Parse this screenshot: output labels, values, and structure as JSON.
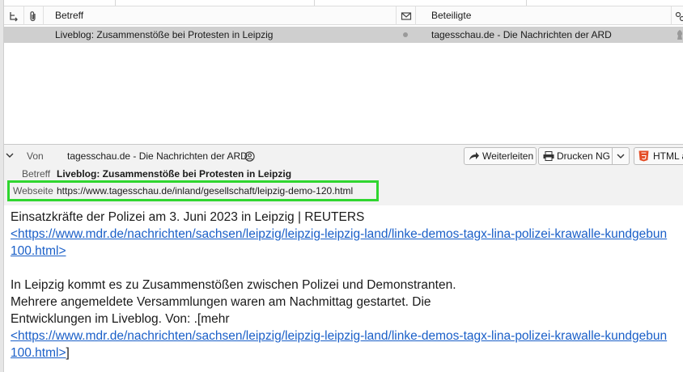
{
  "columns": {
    "subject": "Betreff",
    "participants": "Beteiligte"
  },
  "message_row": {
    "subject": "Liveblog: Zusammenstöße bei Protesten in Leipzig",
    "participants": "tagesschau.de - Die Nachrichten der ARD"
  },
  "header": {
    "from_label": "Von",
    "from_value": "tagesschau.de - Die Nachrichten der ARD",
    "subject_label": "Betreff",
    "subject_value": "Liveblog: Zusammenstöße bei Protesten in Leipzig",
    "website_label": "Webseite",
    "website_url": "https://www.tagesschau.de/inland/gesellschaft/leipzig-demo-120.html",
    "forward_label": "Weiterleiten",
    "print_label": "Drucken NG",
    "html_label": "HTML a"
  },
  "body": {
    "line1": "Einsatzkräfte der Polizei am 3. Juni 2023 in Leipzig | REUTERS",
    "link1_a": "<https://www.mdr.de/nachrichten/sachsen/leipzig/leipzig-leipzig-land/linke-demos-tagx-lina-polizei-krawalle-kundgebun",
    "link1_b": "100.html>",
    "para2_line1": "In Leipzig kommt es zu Zusammenstößen zwischen Polizei und Demonstranten.",
    "para2_line2": "Mehrere angemeldete Versammlungen waren am Nachmittag gestartet. Die",
    "para2_line3": "Entwicklungen im Liveblog. Von: .[mehr",
    "link2_a": "<https://www.mdr.de/nachrichten/sachsen/leipzig/leipzig-leipzig-land/linke-demos-tagx-lina-polizei-krawalle-kundgebun",
    "link2_b": "100.html>",
    "link2_suffix": "]"
  },
  "colors": {
    "selection": "#cfcfcf",
    "link": "#1a5fc8",
    "highlight_box": "#2fd62f"
  }
}
